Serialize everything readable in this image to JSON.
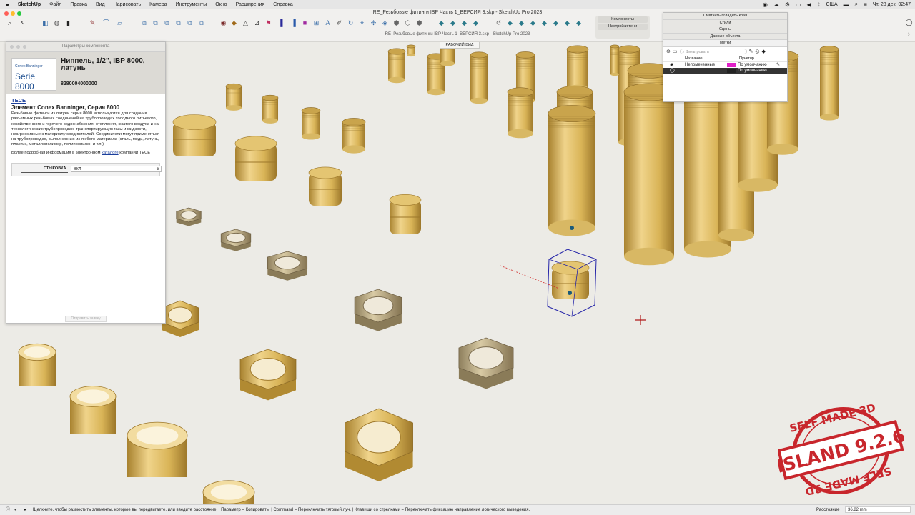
{
  "menubar": {
    "app": "SketchUp",
    "items": [
      "Файл",
      "Правка",
      "Вид",
      "Нарисовать",
      "Камера",
      "Инструменты",
      "Окно",
      "Расширения",
      "Справка"
    ],
    "input_source": "США",
    "clock": "Чт, 28 дек.  02:47"
  },
  "window": {
    "title": "RE_Резьбовые фитинги IBP Часть 1_ВЕРСИЯ 3.skp - SketchUp Pro 2023",
    "subtitle": "RE_Резьбовые фитинги IBP Часть 1_ВЕРСИЯ 3.skp - SketchUp Pro 2023",
    "components_button": "Компоненты",
    "shadow_settings_button": "Настройки тени",
    "view_label": "РАБОЧИЙ ВИД"
  },
  "params_panel": {
    "title": "Параметры компонента",
    "logo_brand": "Conex Banninger",
    "logo_series": "Serie 8000",
    "product_name": "Ниппель, 1/2\", IBP 8000, латунь",
    "product_code": "8280004000000",
    "brand_link": "TECE",
    "series_title": "Элемент Conex Banninger, Серия 8000",
    "description": "Резьбовые фитинги из латуни серия 8000 используются для создания разъемных резьбовых соединений на трубопроводах холодного питьевого, хозяйственного и горячего водоснабжения, отопления, сжатого воздуха и на технологических трубопроводах, транспортирующих газы и жидкости, неагрессивные к материалу соединителей. Соединители могут применяться на трубопроводах, выполненных из любого материала (сталь, медь, латунь, пластик, металлополимер, полипропилен и т.п.)",
    "more_info_prefix": "Более подробная информация в электронном",
    "more_info_link": "каталоге",
    "more_info_suffix": "компании TECE",
    "dock_label": "СТЫКОВКА",
    "dock_value": "ВКЛ",
    "send_button": "Отправить заявку"
  },
  "tray": {
    "soften_edges": "Смягчить/сгладить края",
    "styles": "Стили",
    "scenes": "Сцены",
    "entity_info": "Данные объекта",
    "tags_title": "Метки",
    "filter_placeholder": "Фильтровать",
    "col_name": "Название",
    "col_dashes": "Пунктир",
    "rows": [
      {
        "name": "Непомеченные",
        "color": "#e020c8",
        "dashes": "По умолчанию"
      },
      {
        "name": "",
        "color": "#222222",
        "dashes": "По умолчанию"
      }
    ]
  },
  "statusbar": {
    "text": "Щелкните, чтобы разместить элементы, которые вы передвигаете, или введите расстояние. | Параметр = Копировать. | Command = Переключать тяговый луч. | Клавиши со стрелками = Переключать фиксацию направление логического выведения.",
    "distance_label": "Расстояние",
    "distance_value": "36,82 mm"
  },
  "stamp": {
    "top": "SELF MADE 3D",
    "center": "ISLAND 9.2.6",
    "bottom": "SELF MADE 3D"
  },
  "colors": {
    "brass_light": "#f1d48c",
    "brass_mid": "#d9b457",
    "brass_dark": "#a88232",
    "stamp_red": "#c8262c",
    "selection_blue": "#2323a8"
  }
}
